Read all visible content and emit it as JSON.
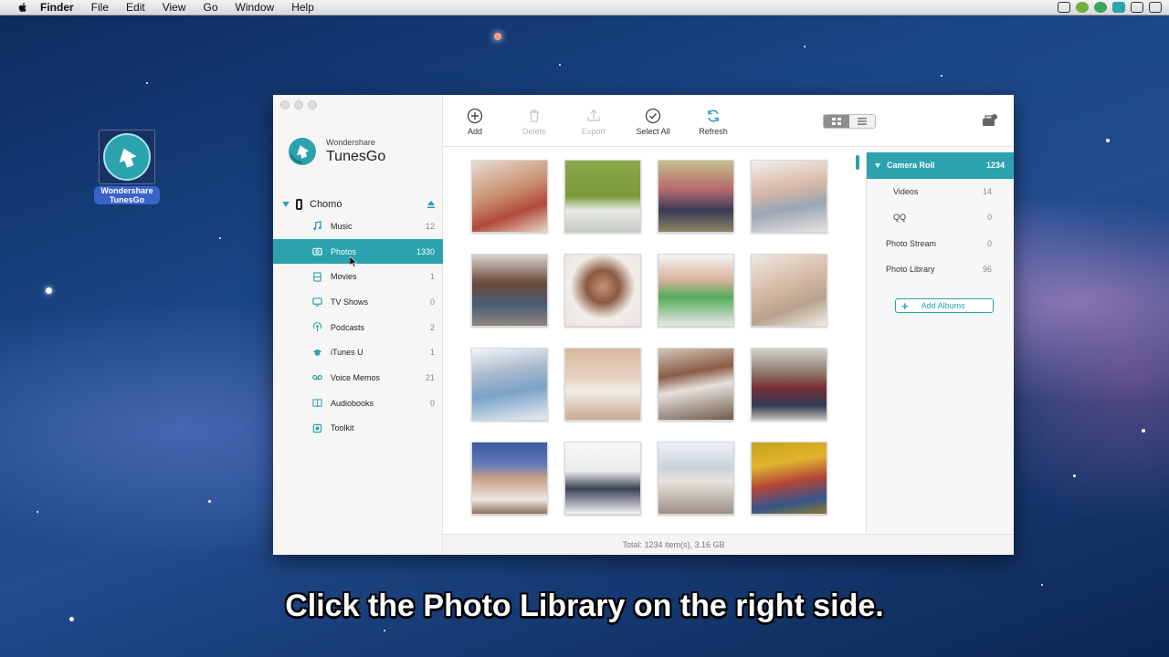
{
  "menubar": {
    "items": [
      "Finder",
      "File",
      "Edit",
      "View",
      "Go",
      "Window",
      "Help"
    ]
  },
  "desktop_icon": {
    "label_line1": "Wondershare",
    "label_line2": "TunesGo"
  },
  "app": {
    "brand_small": "Wondershare",
    "brand_big": "TunesGo",
    "device_name": "Chomo",
    "nav": [
      {
        "label": "Music",
        "count": "12",
        "icon": "music-icon"
      },
      {
        "label": "Photos",
        "count": "1330",
        "icon": "photo-icon",
        "active": true
      },
      {
        "label": "Movies",
        "count": "1",
        "icon": "movie-icon"
      },
      {
        "label": "TV Shows",
        "count": "0",
        "icon": "tv-icon"
      },
      {
        "label": "Podcasts",
        "count": "2",
        "icon": "podcast-icon"
      },
      {
        "label": "iTunes U",
        "count": "1",
        "icon": "graduation-cap-icon"
      },
      {
        "label": "Voice Memos",
        "count": "21",
        "icon": "voicemail-icon"
      },
      {
        "label": "Audiobooks",
        "count": "0",
        "icon": "book-icon"
      },
      {
        "label": "Toolkit",
        "count": "",
        "icon": "toolkit-icon"
      }
    ],
    "toolbar": {
      "add": "Add",
      "delete": "Delete",
      "export": "Export",
      "select_all": "Select All",
      "refresh": "Refresh"
    },
    "albums": [
      {
        "label": "Camera Roll",
        "count": "1234",
        "active": true
      },
      {
        "label": "Videos",
        "count": "14"
      },
      {
        "label": "QQ",
        "count": "0"
      },
      {
        "label": "Photo Stream",
        "count": "0"
      },
      {
        "label": "Photo Library",
        "count": "96"
      }
    ],
    "add_albums": "Add Albums",
    "status": "Total: 1234 item(s), 3.16 GB",
    "accent_color": "#2aa3ae"
  },
  "caption": "Click the Photo Library  on the right side."
}
